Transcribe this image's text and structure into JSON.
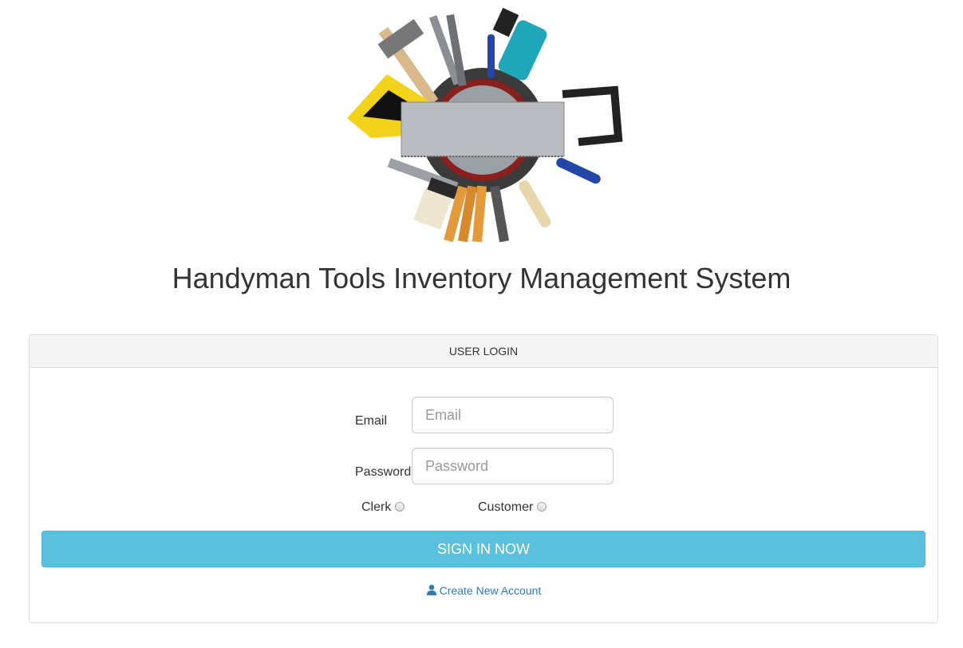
{
  "header": {
    "logo_icon": "tools-collage-icon",
    "title": "Handyman Tools Inventory Management System"
  },
  "login_panel": {
    "heading": "USER LOGIN",
    "email_label": "Email",
    "email_placeholder": "Email",
    "email_value": "",
    "password_label": "Password",
    "password_placeholder": "Password",
    "password_value": "",
    "role_options": [
      {
        "label": "Clerk",
        "selected": false
      },
      {
        "label": "Customer",
        "selected": false
      }
    ],
    "submit_label": "SIGN IN NOW",
    "create_account_icon": "user-icon",
    "create_account_label": "Create New Account"
  },
  "colors": {
    "button": "#5bc0de",
    "link": "#337ab7",
    "heading_bg": "#f5f5f5",
    "border": "#dddddd"
  }
}
